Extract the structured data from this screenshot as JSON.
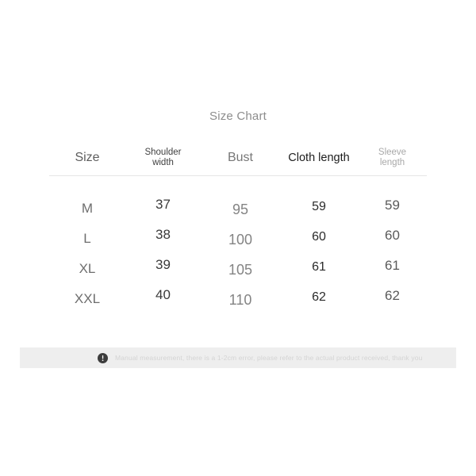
{
  "title": "Size Chart",
  "table": {
    "columns": [
      {
        "key": "size",
        "label": "Size"
      },
      {
        "key": "shoulder",
        "label": "Shoulder width",
        "line1": "Shoulder",
        "line2": "width"
      },
      {
        "key": "bust",
        "label": "Bust"
      },
      {
        "key": "cloth",
        "label": "Cloth length"
      },
      {
        "key": "sleeve",
        "label": "Sleeve length",
        "line1": "Sleeve",
        "line2": "length"
      }
    ],
    "rows": [
      {
        "size": "M",
        "shoulder": "37",
        "bust": "95",
        "cloth": "59",
        "sleeve": "59"
      },
      {
        "size": "L",
        "shoulder": "38",
        "bust": "100",
        "cloth": "60",
        "sleeve": "60"
      },
      {
        "size": "XL",
        "shoulder": "39",
        "bust": "105",
        "cloth": "61",
        "sleeve": "61"
      },
      {
        "size": "XXL",
        "shoulder": "40",
        "bust": "110",
        "cloth": "62",
        "sleeve": "62"
      }
    ]
  },
  "note": {
    "icon": "exclamation-circle-icon",
    "text": "Manual measurement, there is a 1-2cm error, please refer to the actual product received, thank you"
  },
  "colors": {
    "background": "#ffffff",
    "title": "#8d8d8d",
    "divider": "#e6e6e6",
    "note_bar": "#eeeeee",
    "note_text": "#d4d4d4",
    "note_icon": "#3c3c3c",
    "emphasis": "#1d1d1d"
  }
}
